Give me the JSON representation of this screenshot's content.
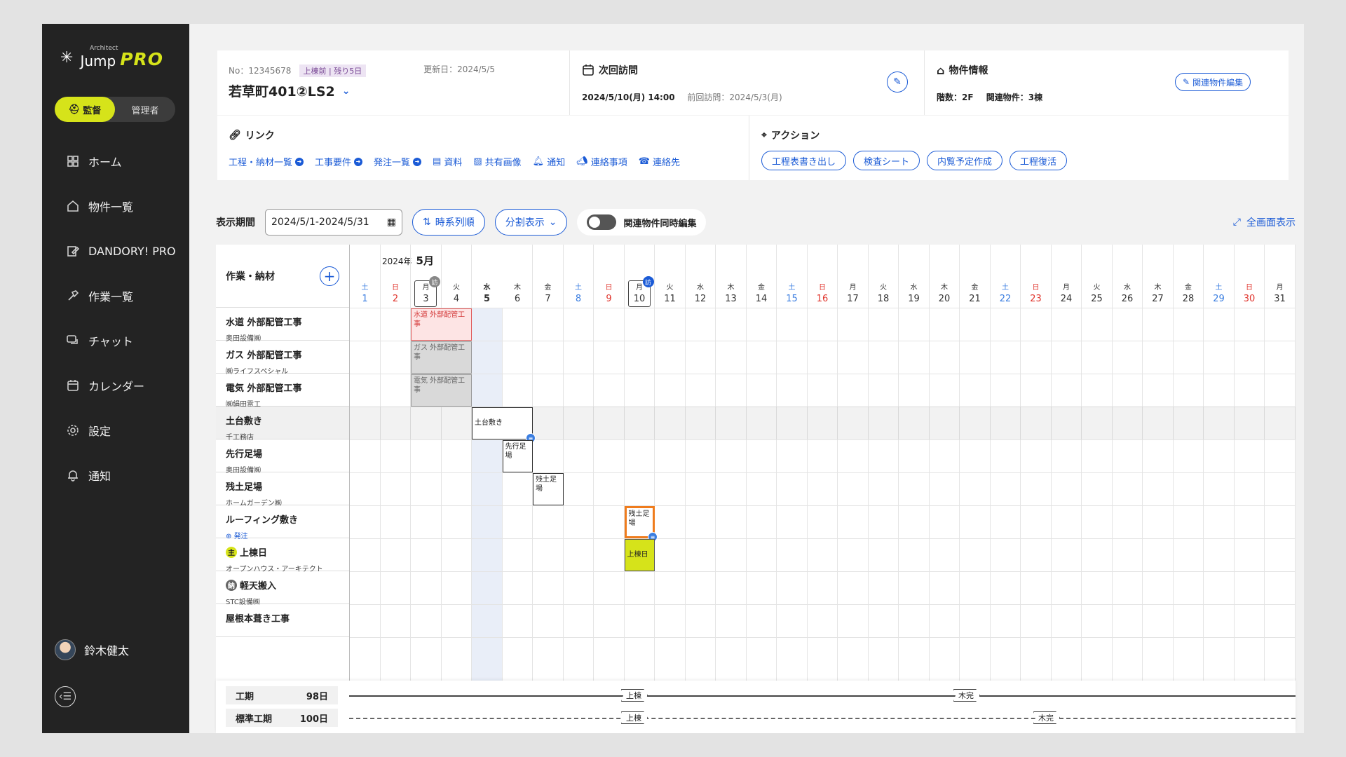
{
  "app": {
    "brand_small": "Architect",
    "brand": "Jump",
    "brand_pro": "PRO",
    "role_active": "監督",
    "role_other": "管理者"
  },
  "nav": [
    {
      "label": "ホーム",
      "icon": "grid-icon"
    },
    {
      "label": "物件一覧",
      "icon": "home-icon"
    },
    {
      "label": "DANDORY! PRO",
      "icon": "edit-doc-icon"
    },
    {
      "label": "作業一覧",
      "icon": "hammer-icon"
    },
    {
      "label": "チャット",
      "icon": "chat-icon"
    },
    {
      "label": "カレンダー",
      "icon": "calendar-icon"
    },
    {
      "label": "設定",
      "icon": "gear-icon"
    },
    {
      "label": "通知",
      "icon": "bell-icon"
    }
  ],
  "user": {
    "name": "鈴木健太"
  },
  "project": {
    "no": "No：12345678",
    "status": "上棟前",
    "remain": "残り5日",
    "updated": "更新日：2024/5/5",
    "name": "若草町401②LS2"
  },
  "visit": {
    "title": "次回訪問",
    "next": "2024/5/10(月) 14:00",
    "prev": "前回訪問：2024/5/3(月)"
  },
  "property": {
    "title": "物件情報",
    "floors": "階数：2F",
    "related": "関連物件：3棟",
    "edit": "関連物件編集"
  },
  "links": {
    "title": "リンク",
    "items": [
      "工程・納材一覧",
      "工事要件",
      "発注一覧",
      "資料",
      "共有画像",
      "通知",
      "連絡事項",
      "連絡先"
    ]
  },
  "actions": {
    "title": "アクション",
    "items": [
      "工程表書き出し",
      "検査シート",
      "内覧予定作成",
      "工程復活"
    ]
  },
  "toolbar": {
    "period_label": "表示期間",
    "period": "2024/5/1-2024/5/31",
    "chrono": "時系列順",
    "split": "分割表示",
    "sync": "関連物件同時編集",
    "fullscreen": "全画面表示"
  },
  "gantt": {
    "header": "作業・納材",
    "year": "2024年",
    "month": "5月",
    "days": [
      {
        "d": "1",
        "w": "土",
        "c": "#3a7de0"
      },
      {
        "d": "2",
        "w": "日",
        "c": "#e0342c"
      },
      {
        "d": "3",
        "w": "月",
        "c": "#333"
      },
      {
        "d": "4",
        "w": "火",
        "c": "#333"
      },
      {
        "d": "5",
        "w": "水",
        "c": "#333"
      },
      {
        "d": "6",
        "w": "木",
        "c": "#333"
      },
      {
        "d": "7",
        "w": "金",
        "c": "#333"
      },
      {
        "d": "8",
        "w": "土",
        "c": "#3a7de0"
      },
      {
        "d": "9",
        "w": "日",
        "c": "#e0342c"
      },
      {
        "d": "10",
        "w": "月",
        "c": "#333"
      },
      {
        "d": "11",
        "w": "火",
        "c": "#333"
      },
      {
        "d": "12",
        "w": "水",
        "c": "#333"
      },
      {
        "d": "13",
        "w": "木",
        "c": "#333"
      },
      {
        "d": "14",
        "w": "金",
        "c": "#333"
      },
      {
        "d": "15",
        "w": "土",
        "c": "#3a7de0"
      },
      {
        "d": "16",
        "w": "日",
        "c": "#e0342c"
      },
      {
        "d": "17",
        "w": "月",
        "c": "#333"
      },
      {
        "d": "18",
        "w": "火",
        "c": "#333"
      },
      {
        "d": "19",
        "w": "水",
        "c": "#333"
      },
      {
        "d": "20",
        "w": "木",
        "c": "#333"
      },
      {
        "d": "21",
        "w": "金",
        "c": "#333"
      },
      {
        "d": "22",
        "w": "土",
        "c": "#3a7de0"
      },
      {
        "d": "23",
        "w": "日",
        "c": "#e0342c"
      },
      {
        "d": "24",
        "w": "月",
        "c": "#333"
      },
      {
        "d": "25",
        "w": "火",
        "c": "#333"
      },
      {
        "d": "26",
        "w": "水",
        "c": "#333"
      },
      {
        "d": "27",
        "w": "木",
        "c": "#333"
      },
      {
        "d": "28",
        "w": "金",
        "c": "#333"
      },
      {
        "d": "29",
        "w": "土",
        "c": "#3a7de0"
      },
      {
        "d": "30",
        "w": "日",
        "c": "#e0342c"
      },
      {
        "d": "31",
        "w": "月",
        "c": "#333"
      }
    ],
    "visit_badge": "訪",
    "tasks": [
      {
        "title": "水道 外部配管工事",
        "sub": "奥田設備㈱"
      },
      {
        "title": "ガス 外部配管工事",
        "sub": "㈱ライフスペシャル"
      },
      {
        "title": "電気 外部配管工事",
        "sub": "㈱絹田電工"
      },
      {
        "title": "土台敷き",
        "sub": "千工務店"
      },
      {
        "title": "先行足場",
        "sub": "奥田設備㈱"
      },
      {
        "title": "残土足場",
        "sub": "ホームガーデン㈱"
      },
      {
        "title": "ルーフィング敷き",
        "sub": "発注"
      },
      {
        "title": "上棟日",
        "sub": "オープンハウス・アーキテクト",
        "badge": "主"
      },
      {
        "title": "軽天搬入",
        "sub": "STC設備㈱",
        "badge": "納"
      },
      {
        "title": "屋根本葺き工事",
        "sub": ""
      }
    ],
    "bars": [
      {
        "label": "水道 外部配管工事",
        "day": 3,
        "len": 2,
        "row": 0,
        "style": "red"
      },
      {
        "label": "ガス 外部配管工事",
        "day": 3,
        "len": 2,
        "row": 1,
        "style": "gray"
      },
      {
        "label": "電気 外部配管工事",
        "day": 3,
        "len": 2,
        "row": 2,
        "style": "gray"
      },
      {
        "label": "土台敷き",
        "day": 5,
        "len": 2,
        "row": 3,
        "style": "white"
      },
      {
        "label": "先行足場",
        "day": 6,
        "len": 1,
        "row": 4,
        "style": "white"
      },
      {
        "label": "残土足場",
        "day": 7,
        "len": 1,
        "row": 5,
        "style": "white"
      },
      {
        "label": "残土足場",
        "day": 10,
        "len": 1,
        "row": 6,
        "style": "orange"
      },
      {
        "label": "上棟日",
        "day": 10,
        "len": 1,
        "row": 7,
        "style": "yellow"
      }
    ]
  },
  "footer": {
    "period_label": "工期",
    "period_value": "98日",
    "std_label": "標準工期",
    "std_value": "100日",
    "m1": "上棟",
    "m2": "木完"
  },
  "colors": {
    "accent": "#1b5bd6",
    "brand_yellow": "#d6e31a",
    "sidebar": "#232323"
  }
}
